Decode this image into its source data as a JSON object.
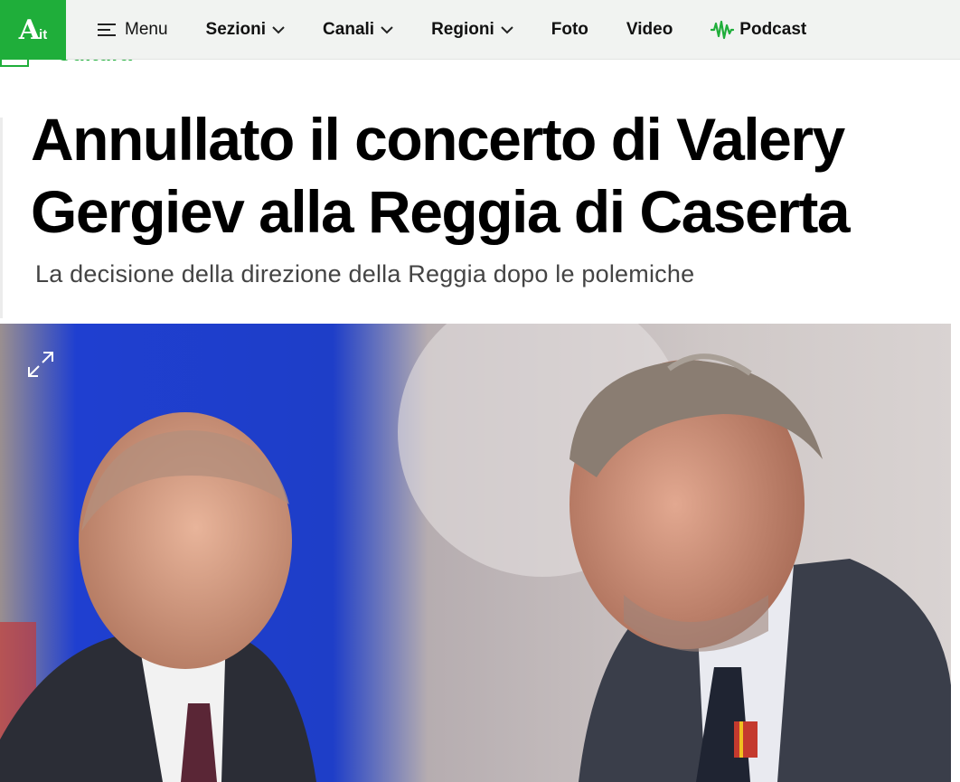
{
  "brand": {
    "logo_text": "Ait",
    "accent": "#1fae3a"
  },
  "nav": {
    "menu_label": "Menu",
    "sections_label": "Sezioni",
    "channels_label": "Canali",
    "regions_label": "Regioni",
    "photo_label": "Foto",
    "video_label": "Video",
    "podcast_label": "Podcast"
  },
  "article": {
    "category": "Cultura",
    "headline_line1": "Annullato il concerto di Valery",
    "headline_line2": "Gergiev alla Reggia di Caserta",
    "subtitle": "La decisione della direzione della Reggia dopo le polemiche"
  },
  "hero": {
    "icon": "expand-icon"
  }
}
